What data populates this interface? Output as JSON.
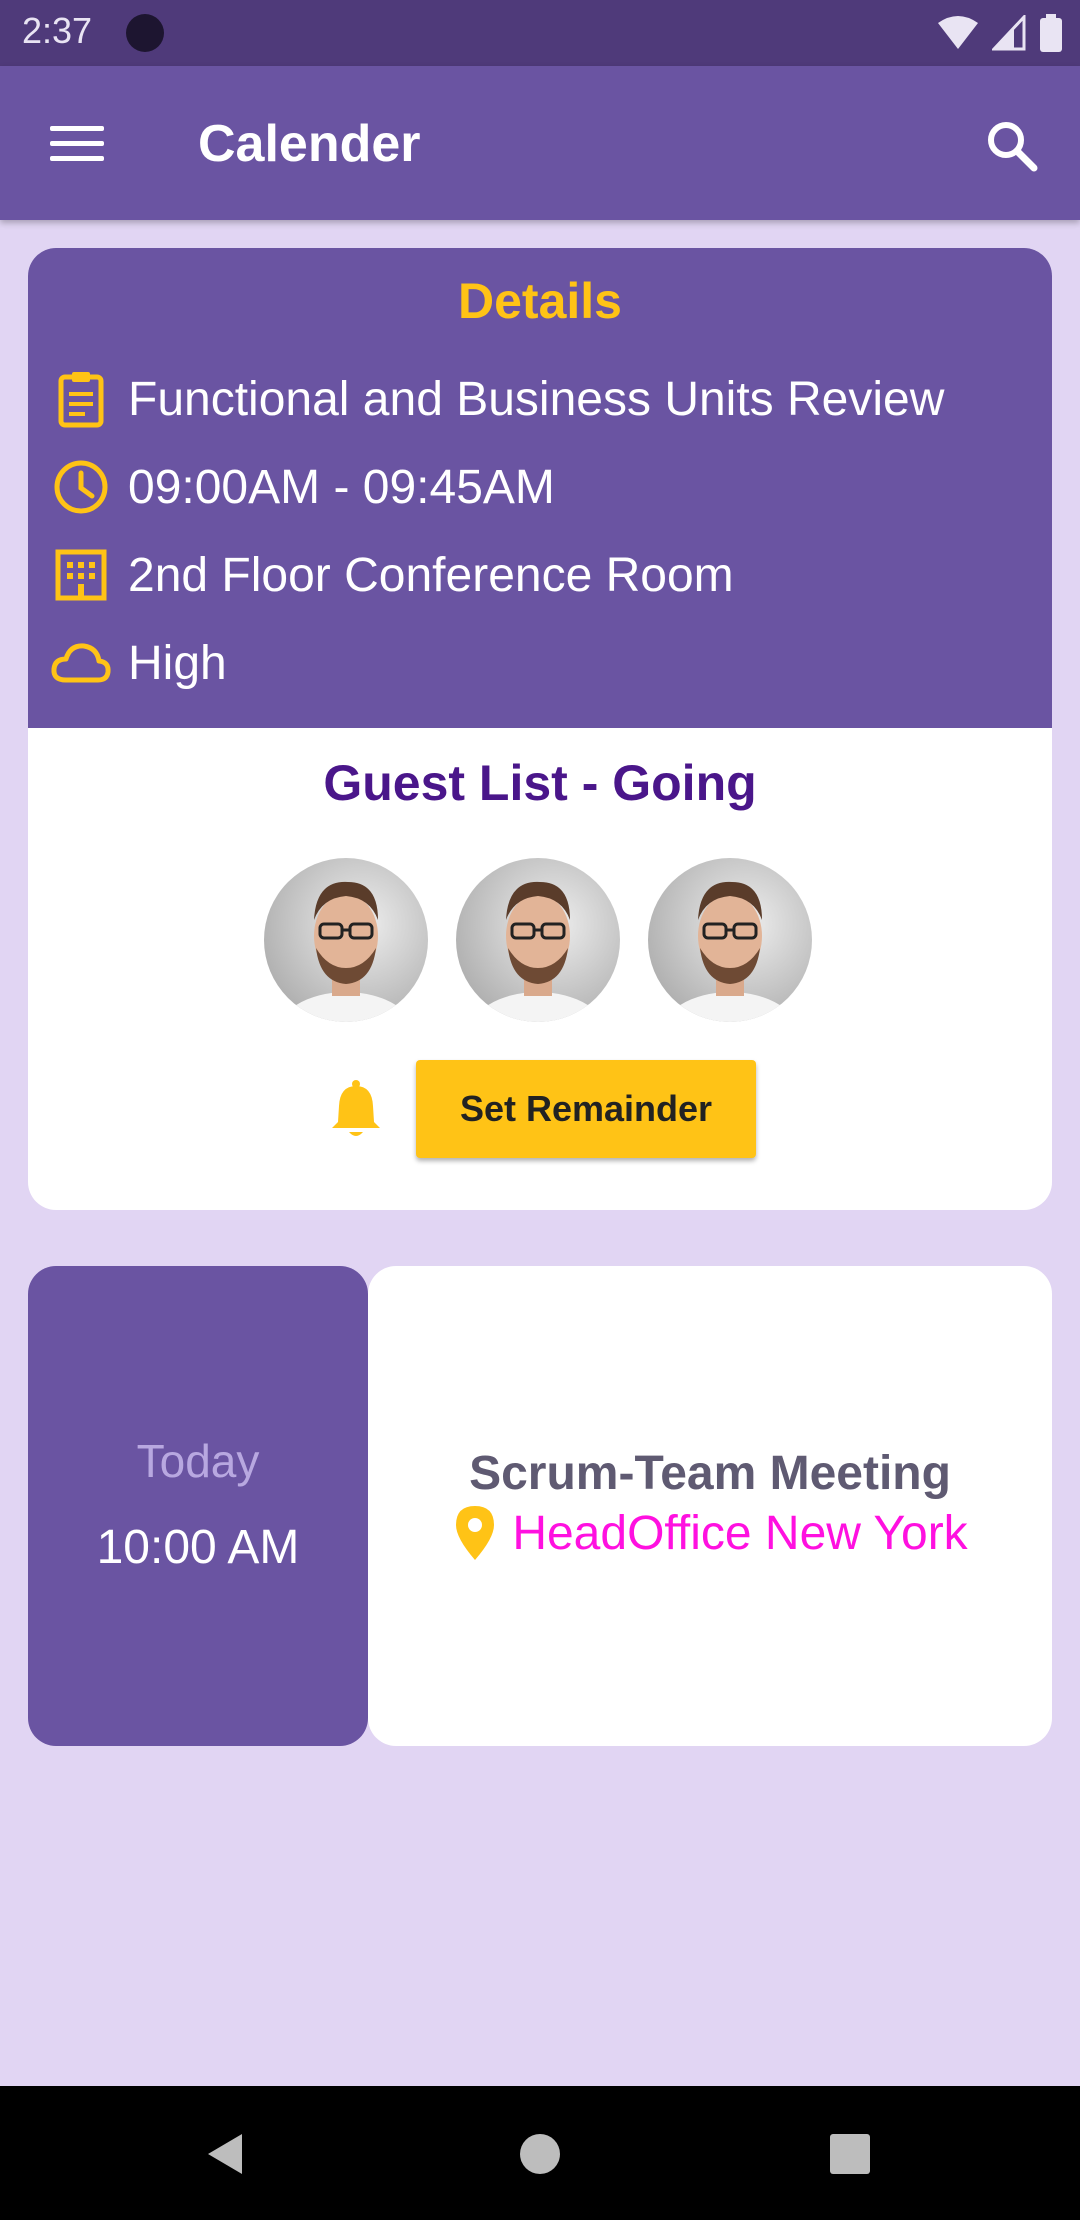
{
  "status_bar": {
    "time": "2:37"
  },
  "app_bar": {
    "title": "Calender"
  },
  "details": {
    "title": "Details",
    "event_title": "Functional and Business Units Review",
    "time_range": "09:00AM - 09:45AM",
    "location": "2nd Floor Conference Room",
    "priority": "High"
  },
  "guests": {
    "title": "Guest List - Going",
    "count": 3
  },
  "reminder": {
    "button_label": "Set Remainder"
  },
  "event": {
    "day": "Today",
    "time": "10:00 AM",
    "name": "Scrum-Team Meeting",
    "location": "HeadOffice New York"
  },
  "colors": {
    "primary": "#6a54a2",
    "accent": "#ffc316",
    "background": "#e1d5f3",
    "guest_title": "#4a168a",
    "location_text": "#ff10e0"
  }
}
